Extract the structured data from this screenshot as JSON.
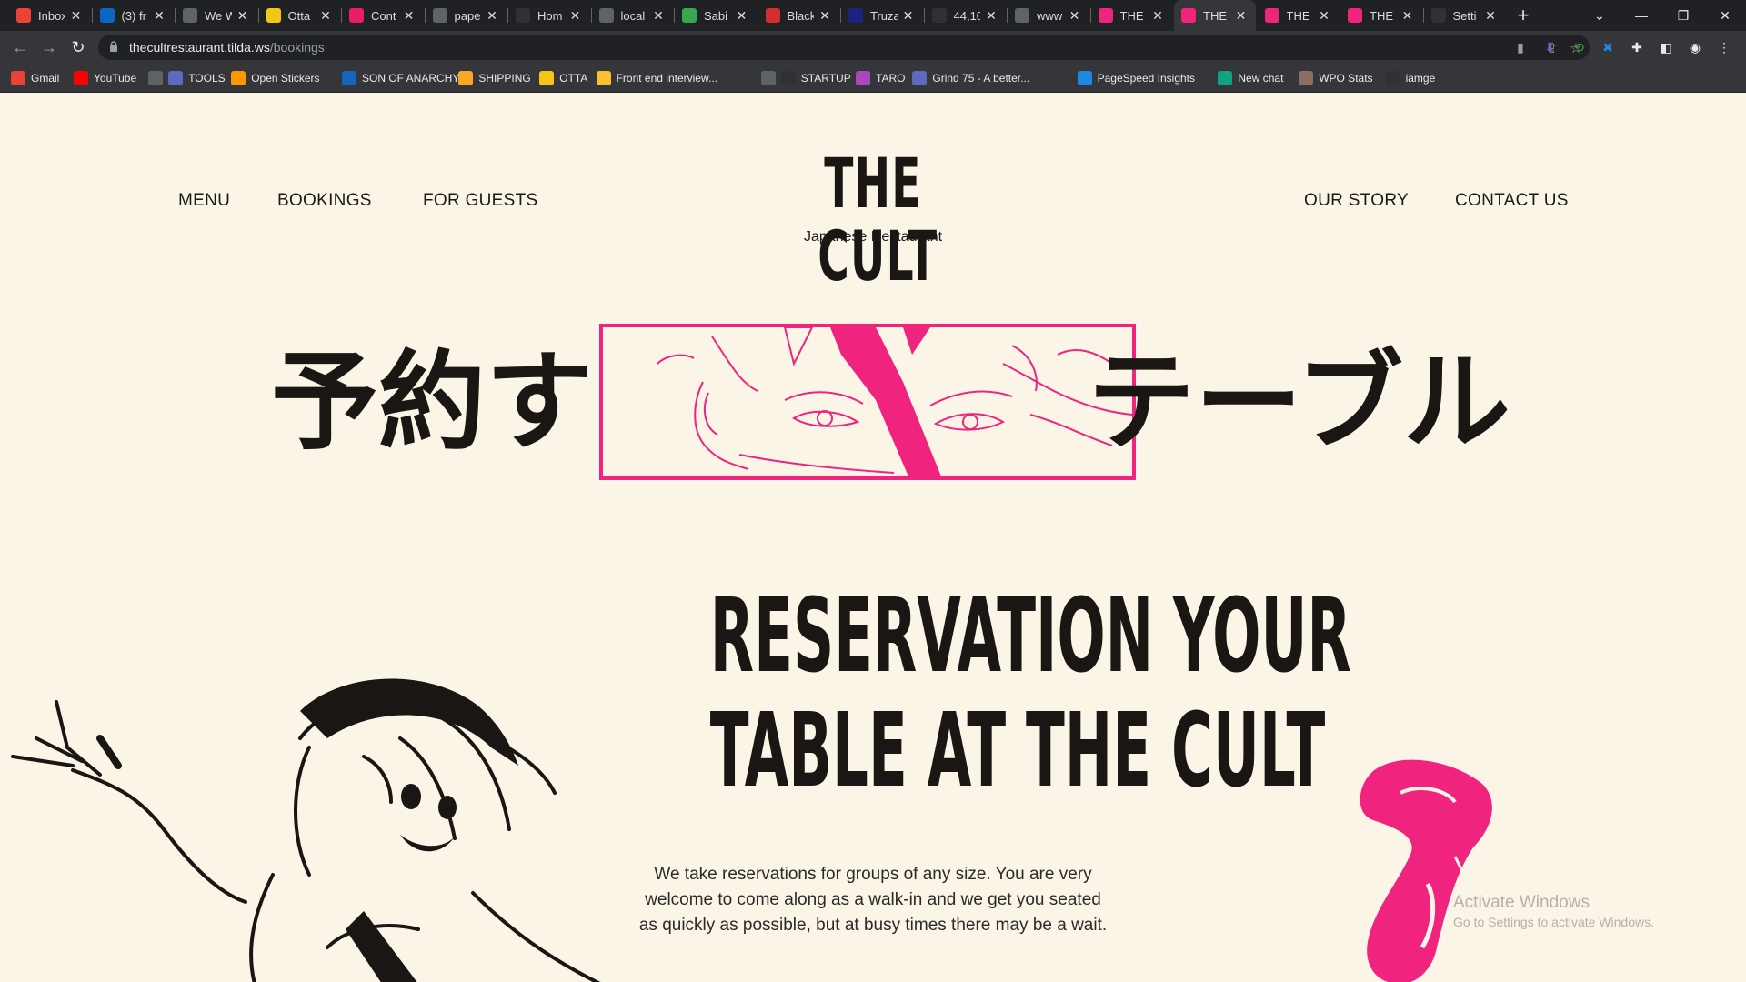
{
  "browser": {
    "tabs": [
      {
        "title": "Inbox",
        "icon": "gmail-icon",
        "color": "#ea4335"
      },
      {
        "title": "(3) fr",
        "icon": "linkedin-icon",
        "color": "#0a66c2"
      },
      {
        "title": "We W",
        "icon": "ww-icon",
        "color": "#5f6368"
      },
      {
        "title": "Otta",
        "icon": "otta-icon",
        "color": "#f5c518"
      },
      {
        "title": "Cont",
        "icon": "contact-icon",
        "color": "#e91e63"
      },
      {
        "title": "pape",
        "icon": "globe-icon",
        "color": "#5f6368"
      },
      {
        "title": "Hom",
        "icon": "home-icon",
        "color": "#303134"
      },
      {
        "title": "local",
        "icon": "globe-icon",
        "color": "#5f6368"
      },
      {
        "title": "Sabi",
        "icon": "maps-pin-icon",
        "color": "#34a853"
      },
      {
        "title": "Black",
        "icon": "black-icon",
        "color": "#d32f2f"
      },
      {
        "title": "Truza",
        "icon": "truza-icon",
        "color": "#1a237e"
      },
      {
        "title": "44,10",
        "icon": "is-icon",
        "color": "#303134"
      },
      {
        "title": "www",
        "icon": "globe-icon",
        "color": "#5f6368"
      },
      {
        "title": "THE (",
        "icon": "cult-icon",
        "color": "#f0247f"
      },
      {
        "title": "THE (",
        "icon": "cult-icon",
        "color": "#f0247f"
      },
      {
        "title": "THE (",
        "icon": "cult-icon",
        "color": "#f0247f"
      },
      {
        "title": "THE (",
        "icon": "cult-icon",
        "color": "#f0247f"
      },
      {
        "title": "Setti",
        "icon": "settings-gear-icon",
        "color": "#303134"
      }
    ],
    "url_host": "thecultrestaurant.tilda.ws",
    "url_path": "/bookings",
    "bookmarks": [
      {
        "label": "Gmail",
        "icon": "gmail-icon",
        "color": "#ea4335"
      },
      {
        "label": "YouTube",
        "icon": "youtube-icon",
        "color": "#ff0000"
      },
      {
        "label": "",
        "icon": "globe-icon",
        "color": "#5f6368"
      },
      {
        "label": "TOOLS",
        "icon": "tools-icon",
        "color": "#5c6bc0"
      },
      {
        "label": "Open Stickers",
        "icon": "stickers-icon",
        "color": "#ff9800"
      },
      {
        "label": "SON OF ANARCHY",
        "icon": "flag-icon",
        "color": "#1565c0"
      },
      {
        "label": "SHIPPING",
        "icon": "shipping-icon",
        "color": "#f9a825"
      },
      {
        "label": "OTTA",
        "icon": "otta-icon",
        "color": "#f5c518"
      },
      {
        "label": "Front end interview...",
        "icon": "bookmark-icon",
        "color": "#fbc02d"
      },
      {
        "label": "",
        "icon": "globe-icon",
        "color": "#5f6368"
      },
      {
        "label": "STARTUP",
        "icon": "startup-icon",
        "color": "#303134"
      },
      {
        "label": "TARO",
        "icon": "taro-icon",
        "color": "#ab47bc"
      },
      {
        "label": "Grind 75 - A better...",
        "icon": "grind-icon",
        "color": "#5c6bc0"
      },
      {
        "label": "PageSpeed Insights",
        "icon": "pagespeed-icon",
        "color": "#1e88e5"
      },
      {
        "label": "New chat",
        "icon": "chat-icon",
        "color": "#10a37f"
      },
      {
        "label": "WPO Stats",
        "icon": "wpo-icon",
        "color": "#8d6e63"
      },
      {
        "label": "iamge",
        "icon": "is-icon",
        "color": "#303134"
      }
    ]
  },
  "site": {
    "nav_left": [
      "MENU",
      "BOOKINGS",
      "FOR GUESTS"
    ],
    "nav_right": [
      "OUR STORY",
      "CONTACT US"
    ],
    "logo_title": "THE CULT",
    "logo_subtitle": "Japanese Restaurant",
    "jp_left": "予約する",
    "jp_right": "テーブル",
    "headline_line1": "RESERVATION YOUR",
    "headline_line2": "TABLE AT THE CULT",
    "intro": "We take reservations for groups of any size. You are very welcome to come along as a walk-in and we get you seated as quickly as possible, but at busy times there may be a wait.",
    "accent_color": "#f0247f"
  },
  "os_watermark": {
    "line1": "Activate Windows",
    "line2": "Go to Settings to activate Windows."
  }
}
